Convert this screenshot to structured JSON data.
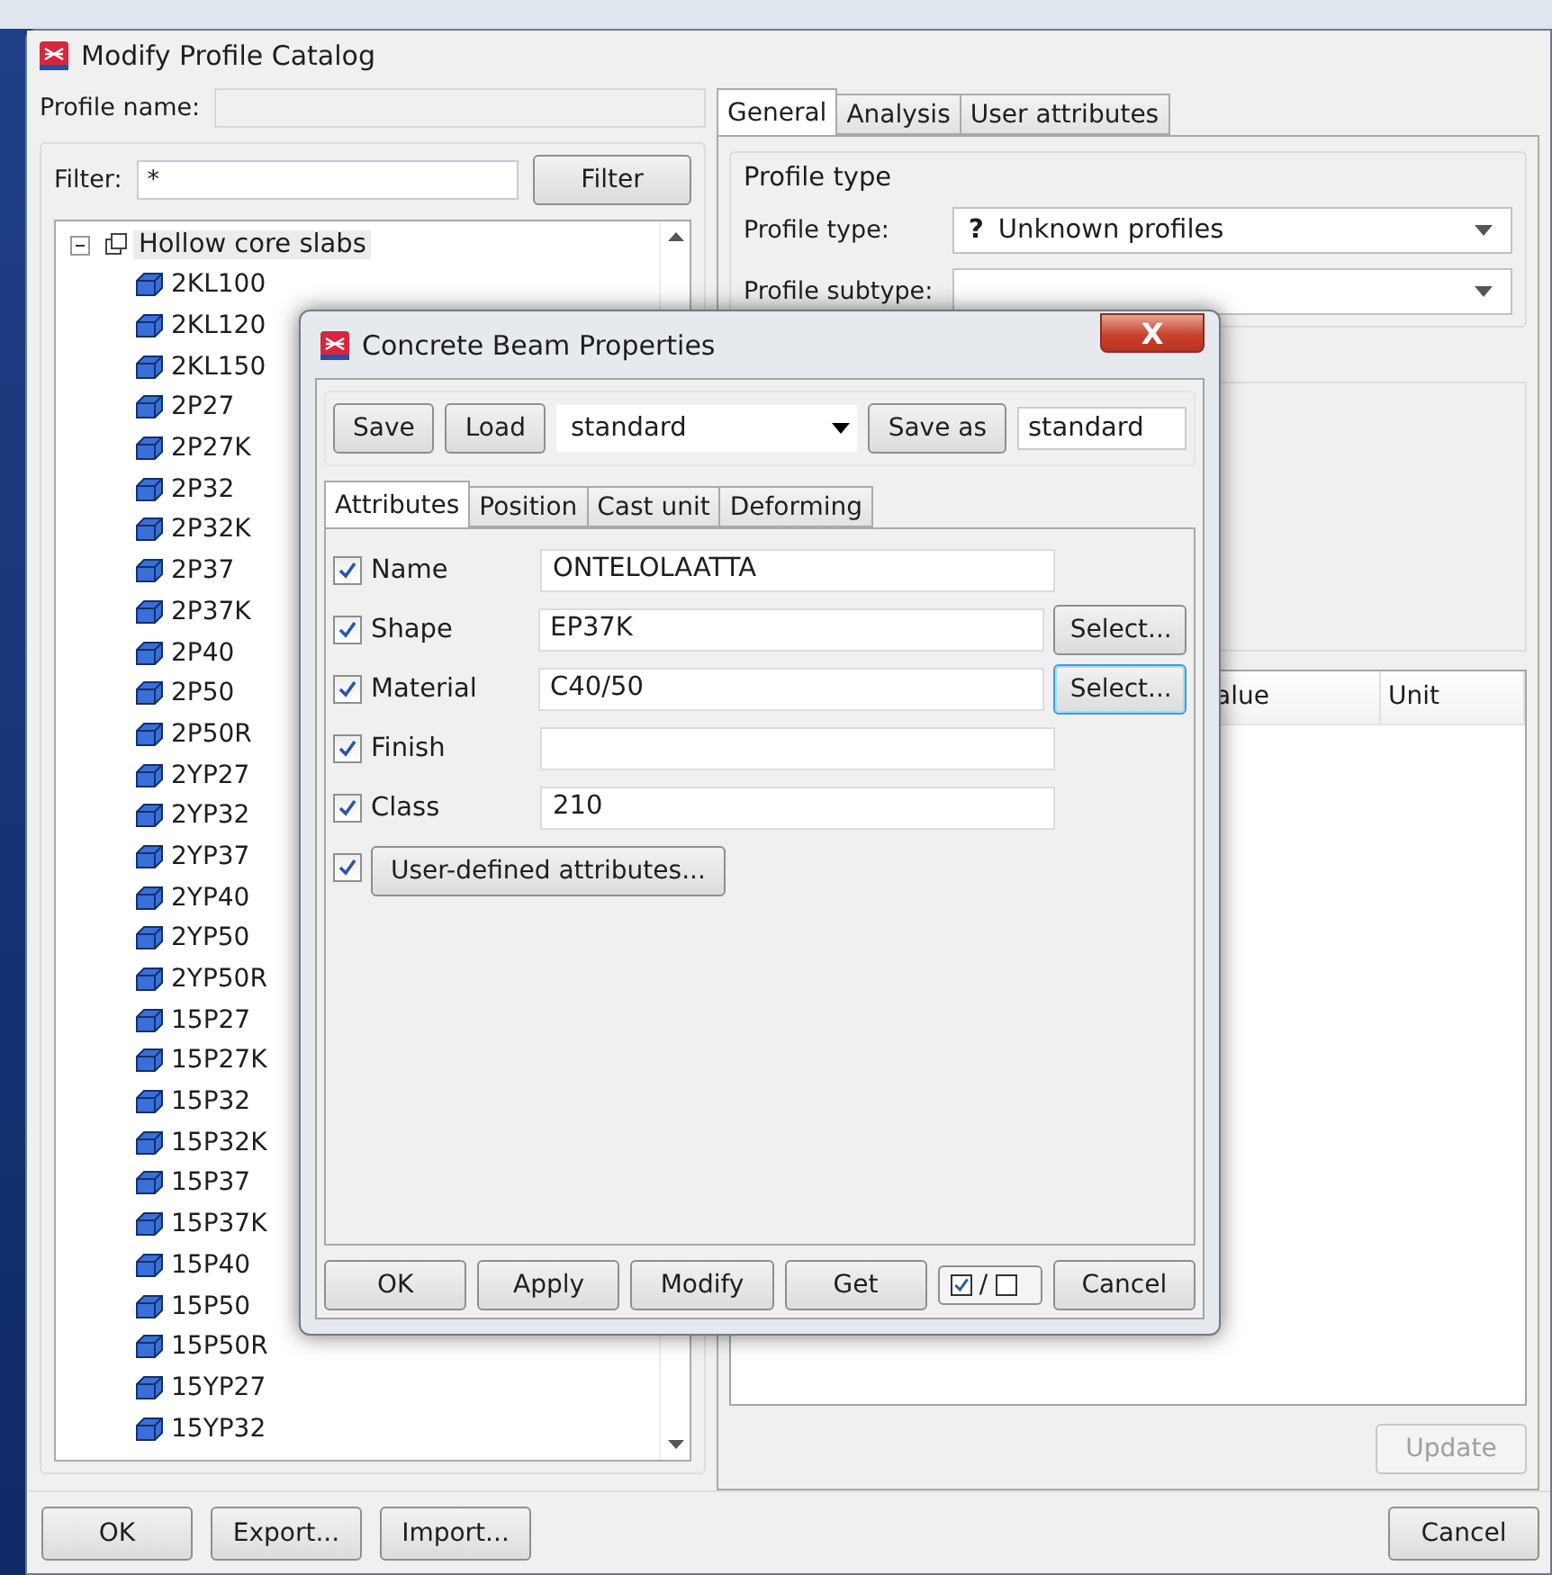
{
  "window": {
    "title": "Modify Profile Catalog"
  },
  "profile_name": {
    "label": "Profile name:"
  },
  "filter": {
    "label": "Filter:",
    "value": "*",
    "button": "Filter"
  },
  "tree": {
    "label": "Hollow core slabs",
    "expanded": true,
    "children": [
      {
        "label": "2KL100"
      },
      {
        "label": "2KL120"
      },
      {
        "label": "2KL150"
      },
      {
        "label": "2P27"
      },
      {
        "label": "2P27K"
      },
      {
        "label": "2P32"
      },
      {
        "label": "2P32K"
      },
      {
        "label": "2P37"
      },
      {
        "label": "2P37K"
      },
      {
        "label": "2P40"
      },
      {
        "label": "2P50"
      },
      {
        "label": "2P50R"
      },
      {
        "label": "2YP27"
      },
      {
        "label": "2YP32"
      },
      {
        "label": "2YP37"
      },
      {
        "label": "2YP40"
      },
      {
        "label": "2YP50"
      },
      {
        "label": "2YP50R"
      },
      {
        "label": "15P27"
      },
      {
        "label": "15P27K"
      },
      {
        "label": "15P32"
      },
      {
        "label": "15P32K"
      },
      {
        "label": "15P37"
      },
      {
        "label": "15P37K"
      },
      {
        "label": "15P40"
      },
      {
        "label": "15P50"
      },
      {
        "label": "15P50R"
      },
      {
        "label": "15YP27"
      },
      {
        "label": "15YP32"
      }
    ]
  },
  "tabs": [
    {
      "label": "General",
      "selected": true
    },
    {
      "label": "Analysis",
      "selected": false
    },
    {
      "label": "User attributes",
      "selected": false
    }
  ],
  "profile_type_group": {
    "title": "Profile type",
    "type_label": "Profile type:",
    "type_icon": "?",
    "type_value": "Unknown profiles",
    "subtype_label": "Profile subtype:"
  },
  "table": {
    "columns": [
      "alue",
      "Unit"
    ]
  },
  "update_button": {
    "label": "Update",
    "disabled": true
  },
  "buttons_left": [
    "OK",
    "Export...",
    "Import..."
  ],
  "button_right": "Cancel",
  "dialog": {
    "title": "Concrete Beam Properties",
    "close": "X",
    "save": "Save",
    "load": "Load",
    "preset": "standard",
    "save_as": "Save as",
    "save_as_name": "standard",
    "tabs": [
      {
        "label": "Attributes",
        "selected": true
      },
      {
        "label": "Position",
        "selected": false
      },
      {
        "label": "Cast unit",
        "selected": false
      },
      {
        "label": "Deforming",
        "selected": false
      }
    ],
    "rows": [
      {
        "kind": "field",
        "label": "Name",
        "value": "ONTELOLAATTA",
        "checked": true
      },
      {
        "kind": "select",
        "label": "Shape",
        "value": "EP37K",
        "checked": true,
        "button": "Select...",
        "focused": false
      },
      {
        "kind": "select",
        "label": "Material",
        "value": "C40/50",
        "checked": true,
        "button": "Select...",
        "focused": true
      },
      {
        "kind": "field",
        "label": "Finish",
        "value": "",
        "checked": true
      },
      {
        "kind": "field",
        "label": "Class",
        "value": "210",
        "checked": true
      },
      {
        "kind": "button",
        "label": "User-defined attributes...",
        "checked": true
      }
    ],
    "buttons": [
      {
        "kind": "text",
        "label": "OK"
      },
      {
        "kind": "text",
        "label": "Apply"
      },
      {
        "kind": "text",
        "label": "Modify"
      },
      {
        "kind": "text",
        "label": "Get"
      },
      {
        "kind": "toggle",
        "label": "/"
      },
      {
        "kind": "text",
        "label": "Cancel"
      }
    ]
  }
}
